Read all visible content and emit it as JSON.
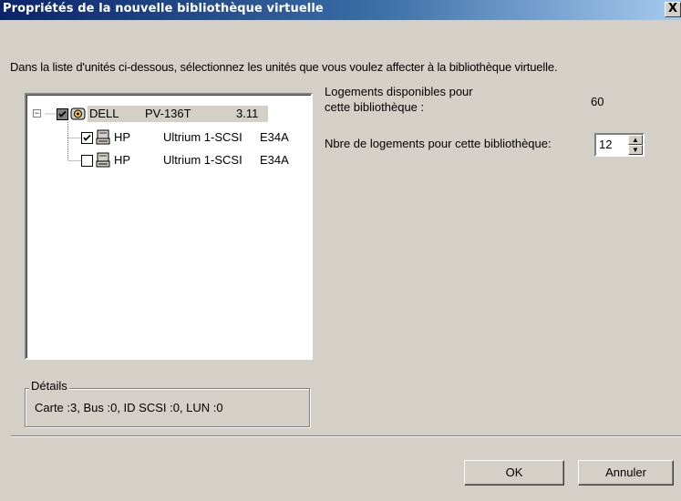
{
  "window": {
    "title": "Propriétés de la nouvelle bibliothèque virtuelle",
    "close_glyph": "X"
  },
  "instructions": "Dans la liste d'unités ci-dessous, sélectionnez les unités que vous voulez affecter à la bibliothèque virtuelle.",
  "tree": {
    "root": {
      "vendor": "DELL",
      "model": "PV-136T",
      "revision": "3.11",
      "checkbox": "indeterminate",
      "icon": "library-icon",
      "expanded": true
    },
    "children": [
      {
        "vendor": "HP",
        "model": "Ultrium 1-SCSI",
        "revision": "E34A",
        "checked": true,
        "icon": "tape-drive-icon"
      },
      {
        "vendor": "HP",
        "model": "Ultrium 1-SCSI",
        "revision": "E34A",
        "checked": false,
        "icon": "tape-drive-icon"
      }
    ]
  },
  "details": {
    "legend": "Détails",
    "text": "Carte :3, Bus :0, ID SCSI :0, LUN :0"
  },
  "slots": {
    "label_line1": "Logements disponibles pour",
    "label_line2": "cette bibliothèque :",
    "value": "60"
  },
  "num_slots": {
    "label": "Nbre de logements pour cette bibliothèque:",
    "value": "12"
  },
  "buttons": {
    "ok": "OK",
    "cancel": "Annuler"
  }
}
